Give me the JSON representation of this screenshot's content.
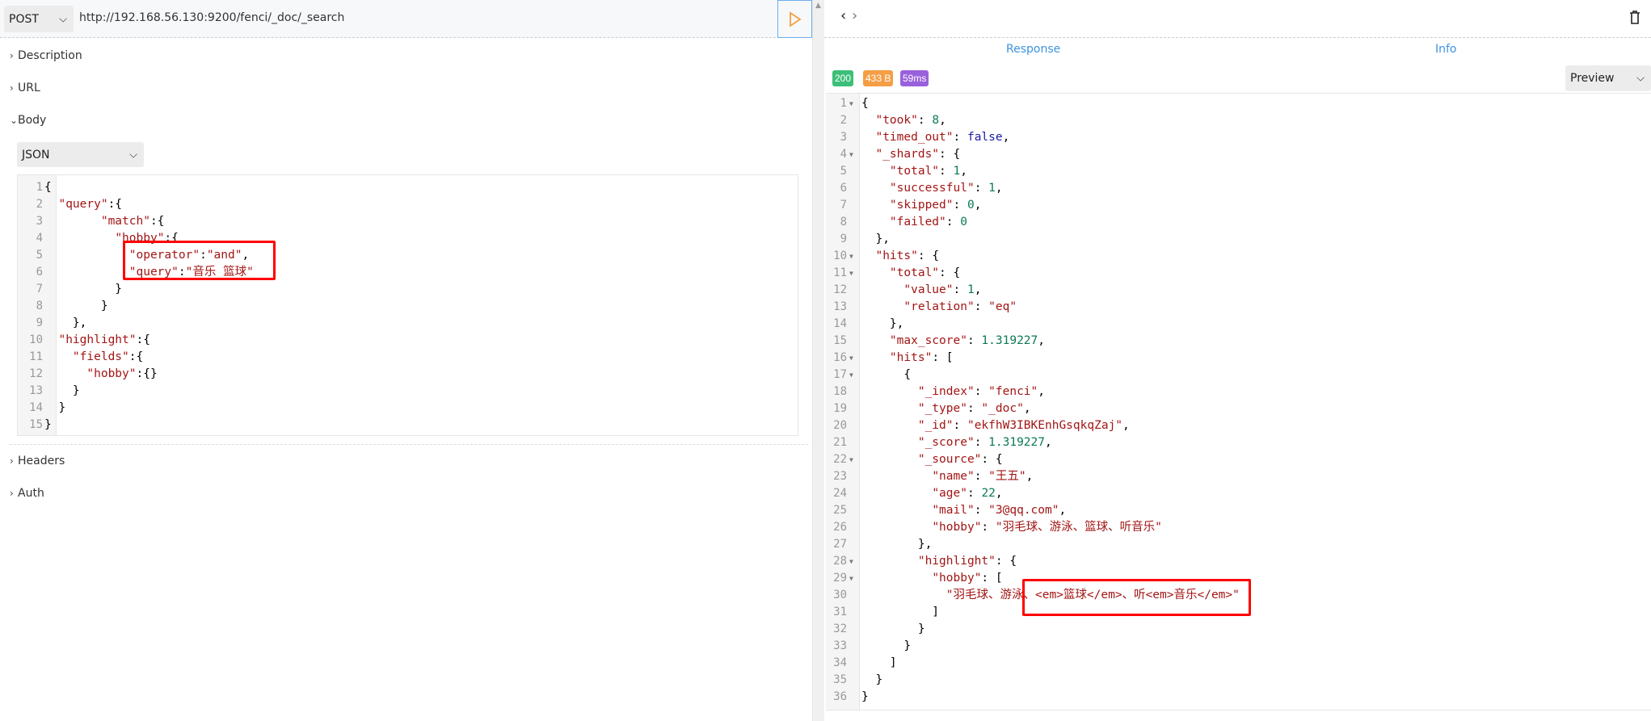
{
  "request": {
    "method": "POST",
    "url": "http://192.168.56.130:9200/fenci/_doc/_search",
    "send_icon": "play-icon",
    "sections": {
      "description": "Description",
      "url": "URL",
      "body": "Body",
      "headers": "Headers",
      "auth": "Auth"
    },
    "body_type": "JSON",
    "body_lines": [
      [
        [
          "p",
          "{"
        ]
      ],
      [
        [
          "p",
          "  "
        ],
        [
          "k",
          "\"query\""
        ],
        [
          "p",
          ":{"
        ]
      ],
      [
        [
          "p",
          "        "
        ],
        [
          "k",
          "\"match\""
        ],
        [
          "p",
          ":{"
        ]
      ],
      [
        [
          "p",
          "          "
        ],
        [
          "k",
          "\"hobby\""
        ],
        [
          "p",
          ":{"
        ]
      ],
      [
        [
          "p",
          "            "
        ],
        [
          "k",
          "\"operator\""
        ],
        [
          "p",
          ":"
        ],
        [
          "s",
          "\"and\""
        ],
        [
          "p",
          ","
        ]
      ],
      [
        [
          "p",
          "            "
        ],
        [
          "k",
          "\"query\""
        ],
        [
          "p",
          ":"
        ],
        [
          "s",
          "\"音乐 篮球\""
        ]
      ],
      [
        [
          "p",
          "          }"
        ]
      ],
      [
        [
          "p",
          "        }"
        ]
      ],
      [
        [
          "p",
          "    },"
        ]
      ],
      [
        [
          "p",
          "  "
        ],
        [
          "k",
          "\"highlight\""
        ],
        [
          "p",
          ":{"
        ]
      ],
      [
        [
          "p",
          "    "
        ],
        [
          "k",
          "\"fields\""
        ],
        [
          "p",
          ":{"
        ]
      ],
      [
        [
          "p",
          "      "
        ],
        [
          "k",
          "\"hobby\""
        ],
        [
          "p",
          ":{}"
        ]
      ],
      [
        [
          "p",
          "    }"
        ]
      ],
      [
        [
          "p",
          "  }"
        ]
      ],
      [
        [
          "p",
          "}"
        ]
      ]
    ]
  },
  "response": {
    "nav_back": "‹",
    "nav_forward": "›",
    "trash_icon": "trash-icon",
    "tabs": [
      "Response",
      "Info"
    ],
    "status": "200",
    "size": "433 B",
    "time": "59ms",
    "colors": {
      "status": "#3cbf78",
      "size": "#f59e45",
      "time": "#9a61dc",
      "tab": "#3d93e0"
    },
    "view_mode": "Preview",
    "fold_lines": [
      1,
      4,
      10,
      11,
      16,
      17,
      22,
      28,
      29
    ],
    "lines": [
      [
        [
          "p",
          "{"
        ]
      ],
      [
        [
          "p",
          "  "
        ],
        [
          "k",
          "\"took\""
        ],
        [
          "p",
          ": "
        ],
        [
          "n",
          "8"
        ],
        [
          "p",
          ","
        ]
      ],
      [
        [
          "p",
          "  "
        ],
        [
          "k",
          "\"timed_out\""
        ],
        [
          "p",
          ": "
        ],
        [
          "b",
          "false"
        ],
        [
          "p",
          ","
        ]
      ],
      [
        [
          "p",
          "  "
        ],
        [
          "k",
          "\"_shards\""
        ],
        [
          "p",
          ": {"
        ]
      ],
      [
        [
          "p",
          "    "
        ],
        [
          "k",
          "\"total\""
        ],
        [
          "p",
          ": "
        ],
        [
          "n",
          "1"
        ],
        [
          "p",
          ","
        ]
      ],
      [
        [
          "p",
          "    "
        ],
        [
          "k",
          "\"successful\""
        ],
        [
          "p",
          ": "
        ],
        [
          "n",
          "1"
        ],
        [
          "p",
          ","
        ]
      ],
      [
        [
          "p",
          "    "
        ],
        [
          "k",
          "\"skipped\""
        ],
        [
          "p",
          ": "
        ],
        [
          "n",
          "0"
        ],
        [
          "p",
          ","
        ]
      ],
      [
        [
          "p",
          "    "
        ],
        [
          "k",
          "\"failed\""
        ],
        [
          "p",
          ": "
        ],
        [
          "n",
          "0"
        ]
      ],
      [
        [
          "p",
          "  },"
        ]
      ],
      [
        [
          "p",
          "  "
        ],
        [
          "k",
          "\"hits\""
        ],
        [
          "p",
          ": {"
        ]
      ],
      [
        [
          "p",
          "    "
        ],
        [
          "k",
          "\"total\""
        ],
        [
          "p",
          ": {"
        ]
      ],
      [
        [
          "p",
          "      "
        ],
        [
          "k",
          "\"value\""
        ],
        [
          "p",
          ": "
        ],
        [
          "n",
          "1"
        ],
        [
          "p",
          ","
        ]
      ],
      [
        [
          "p",
          "      "
        ],
        [
          "k",
          "\"relation\""
        ],
        [
          "p",
          ": "
        ],
        [
          "s",
          "\"eq\""
        ]
      ],
      [
        [
          "p",
          "    },"
        ]
      ],
      [
        [
          "p",
          "    "
        ],
        [
          "k",
          "\"max_score\""
        ],
        [
          "p",
          ": "
        ],
        [
          "n",
          "1.319227"
        ],
        [
          "p",
          ","
        ]
      ],
      [
        [
          "p",
          "    "
        ],
        [
          "k",
          "\"hits\""
        ],
        [
          "p",
          ": ["
        ]
      ],
      [
        [
          "p",
          "      {"
        ]
      ],
      [
        [
          "p",
          "        "
        ],
        [
          "k",
          "\"_index\""
        ],
        [
          "p",
          ": "
        ],
        [
          "s",
          "\"fenci\""
        ],
        [
          "p",
          ","
        ]
      ],
      [
        [
          "p",
          "        "
        ],
        [
          "k",
          "\"_type\""
        ],
        [
          "p",
          ": "
        ],
        [
          "s",
          "\"_doc\""
        ],
        [
          "p",
          ","
        ]
      ],
      [
        [
          "p",
          "        "
        ],
        [
          "k",
          "\"_id\""
        ],
        [
          "p",
          ": "
        ],
        [
          "s",
          "\"ekfhW3IBKEnhGsqkqZaj\""
        ],
        [
          "p",
          ","
        ]
      ],
      [
        [
          "p",
          "        "
        ],
        [
          "k",
          "\"_score\""
        ],
        [
          "p",
          ": "
        ],
        [
          "n",
          "1.319227"
        ],
        [
          "p",
          ","
        ]
      ],
      [
        [
          "p",
          "        "
        ],
        [
          "k",
          "\"_source\""
        ],
        [
          "p",
          ": {"
        ]
      ],
      [
        [
          "p",
          "          "
        ],
        [
          "k",
          "\"name\""
        ],
        [
          "p",
          ": "
        ],
        [
          "s",
          "\"王五\""
        ],
        [
          "p",
          ","
        ]
      ],
      [
        [
          "p",
          "          "
        ],
        [
          "k",
          "\"age\""
        ],
        [
          "p",
          ": "
        ],
        [
          "n",
          "22"
        ],
        [
          "p",
          ","
        ]
      ],
      [
        [
          "p",
          "          "
        ],
        [
          "k",
          "\"mail\""
        ],
        [
          "p",
          ": "
        ],
        [
          "s",
          "\"3@qq.com\""
        ],
        [
          "p",
          ","
        ]
      ],
      [
        [
          "p",
          "          "
        ],
        [
          "k",
          "\"hobby\""
        ],
        [
          "p",
          ": "
        ],
        [
          "s",
          "\"羽毛球、游泳、篮球、听音乐\""
        ]
      ],
      [
        [
          "p",
          "        },"
        ]
      ],
      [
        [
          "p",
          "        "
        ],
        [
          "k",
          "\"highlight\""
        ],
        [
          "p",
          ": {"
        ]
      ],
      [
        [
          "p",
          "          "
        ],
        [
          "k",
          "\"hobby\""
        ],
        [
          "p",
          ": ["
        ]
      ],
      [
        [
          "p",
          "            "
        ],
        [
          "s",
          "\"羽毛球、游泳、<em>篮球</em>、听<em>音乐</em>\""
        ]
      ],
      [
        [
          "p",
          "          ]"
        ]
      ],
      [
        [
          "p",
          "        }"
        ]
      ],
      [
        [
          "p",
          "      }"
        ]
      ],
      [
        [
          "p",
          "    ]"
        ]
      ],
      [
        [
          "p",
          "  }"
        ]
      ],
      [
        [
          "p",
          "}"
        ]
      ]
    ]
  }
}
